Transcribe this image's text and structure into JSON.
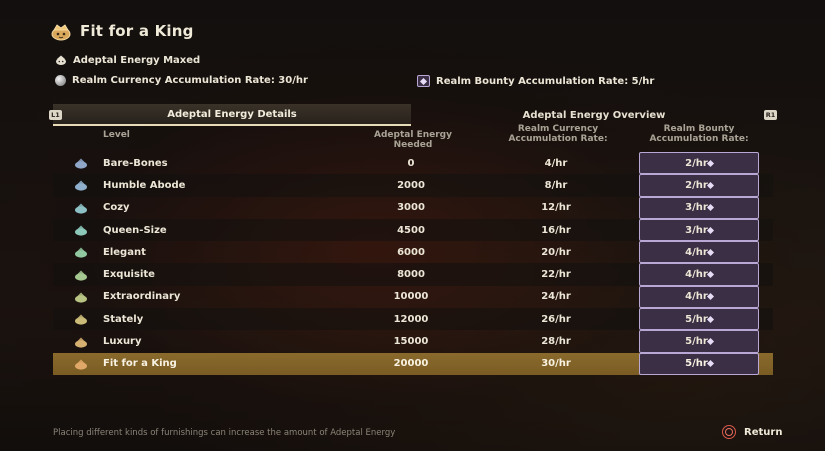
{
  "header": {
    "title": "Fit for a King",
    "icon": "teapot-crown-icon"
  },
  "status": {
    "label": "Adeptal Energy Maxed",
    "icon": "teapot-icon"
  },
  "rates": {
    "currency_label": "Realm Currency Accumulation Rate: 30/hr",
    "bounty_label": "Realm Bounty Accumulation Rate: 5/hr"
  },
  "tabs": {
    "details": "Adeptal Energy Details",
    "overview": "Adeptal Energy Overview",
    "left_key": "L1",
    "right_key": "R1"
  },
  "table": {
    "columns": {
      "level": "Level",
      "energy": "Adeptal Energy Needed",
      "currency": "Realm Currency Accumulation Rate:",
      "bounty": "Realm Bounty Accumulation Rate:"
    },
    "rows": [
      {
        "level": "Bare-Bones",
        "energy": "0",
        "currency": "4/hr",
        "bounty": "2/hr",
        "color": "#8fa6c8"
      },
      {
        "level": "Humble Abode",
        "energy": "2000",
        "currency": "8/hr",
        "bounty": "2/hr",
        "color": "#8fb0cc"
      },
      {
        "level": "Cozy",
        "energy": "3000",
        "currency": "12/hr",
        "bounty": "3/hr",
        "color": "#8cc0c4"
      },
      {
        "level": "Queen-Size",
        "energy": "4500",
        "currency": "16/hr",
        "bounty": "3/hr",
        "color": "#8cc8b8"
      },
      {
        "level": "Elegant",
        "energy": "6000",
        "currency": "20/hr",
        "bounty": "4/hr",
        "color": "#92c8a0"
      },
      {
        "level": "Exquisite",
        "energy": "8000",
        "currency": "22/hr",
        "bounty": "4/hr",
        "color": "#a4c890"
      },
      {
        "level": "Extraordinary",
        "energy": "10000",
        "currency": "24/hr",
        "bounty": "4/hr",
        "color": "#b8c484"
      },
      {
        "level": "Stately",
        "energy": "12000",
        "currency": "26/hr",
        "bounty": "5/hr",
        "color": "#cabc78"
      },
      {
        "level": "Luxury",
        "energy": "15000",
        "currency": "28/hr",
        "bounty": "5/hr",
        "color": "#d6b070"
      },
      {
        "level": "Fit for a King",
        "energy": "20000",
        "currency": "30/hr",
        "bounty": "5/hr",
        "color": "#e0a868"
      }
    ],
    "current_row_index": 9
  },
  "footer": {
    "note": "Placing different kinds of furnishings can increase the amount of Adeptal Energy",
    "return_label": "Return"
  },
  "colors": {
    "highlight": "#8a6a2c",
    "active_tab_underline": "#e8dcb8",
    "return_button": "#d95a4a"
  }
}
